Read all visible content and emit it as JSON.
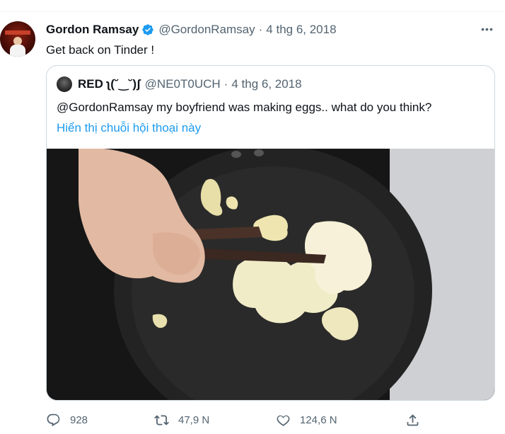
{
  "tweet": {
    "author_name": "Gordon Ramsay",
    "author_handle": "@GordonRamsay",
    "separator": "·",
    "date": "4 thg 6, 2018",
    "text": "Get back on Tinder !",
    "more_label": "•••"
  },
  "quoted": {
    "author_name": "RED ʅ(˘‿˘)ʃ",
    "author_handle": "@NE0T0UCH",
    "separator": "·",
    "date": "4 thg 6, 2018",
    "text": "@GordonRamsay my boyfriend was making eggs.. what do you think?",
    "thread_link": "Hiển thị chuỗi hội thoại này"
  },
  "actions": {
    "reply_count": "928",
    "retweet_count": "47,9 N",
    "like_count": "124,6 N"
  },
  "colors": {
    "verified": "#1d9bf0",
    "link": "#1d9bf0",
    "muted": "#536471",
    "border": "#cfd9de"
  },
  "icons": {
    "verified": "verified-badge-icon",
    "more": "more-dots-icon",
    "reply": "reply-icon",
    "retweet": "retweet-icon",
    "like": "heart-icon",
    "share": "share-icon"
  }
}
